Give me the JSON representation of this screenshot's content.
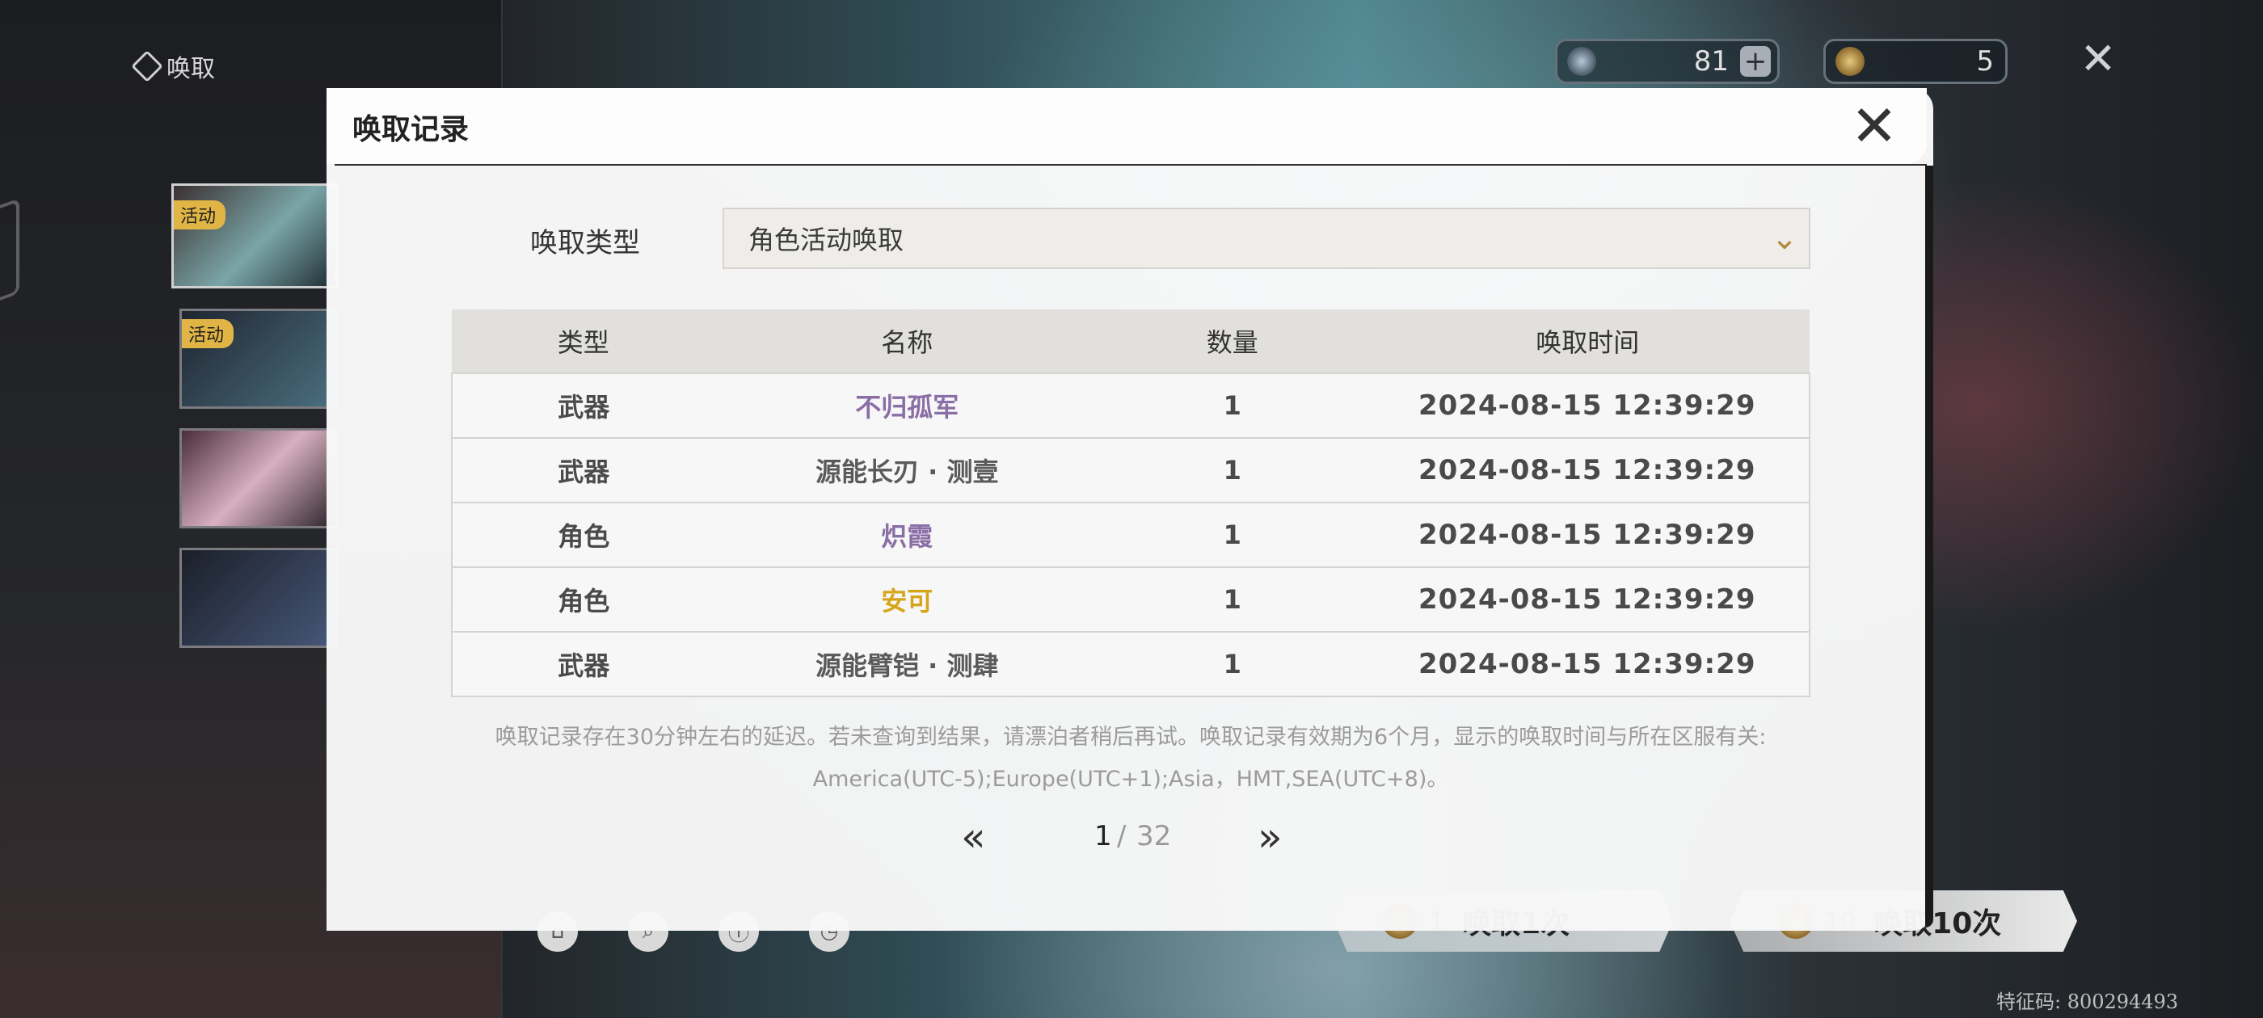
{
  "background": {
    "nav_title": "唤取",
    "side_tags": [
      "活动",
      "活动"
    ],
    "resources": {
      "star_count": "81",
      "coin_count": "5",
      "plus_label": "+"
    },
    "pull_buttons": {
      "single_label": "唤取1次",
      "single_cost": "1",
      "ten_label": "唤取10次",
      "ten_cost": "10"
    },
    "feature_code": "特征码: 800294493"
  },
  "modal": {
    "title": "唤取记录",
    "filter": {
      "label": "唤取类型",
      "selected": "角色活动唤取"
    },
    "table": {
      "headers": [
        "类型",
        "名称",
        "数量",
        "唤取时间"
      ],
      "rows": [
        {
          "type": "武器",
          "name": "不归孤军",
          "qty": "1",
          "time": "2024-08-15 12:39:29",
          "color": "#8a6ea6"
        },
        {
          "type": "武器",
          "name": "源能长刃 · 测壹",
          "qty": "1",
          "time": "2024-08-15 12:39:29",
          "color": "#5a5a5a"
        },
        {
          "type": "角色",
          "name": "炽霞",
          "qty": "1",
          "time": "2024-08-15 12:39:29",
          "color": "#8a6ea6"
        },
        {
          "type": "角色",
          "name": "安可",
          "qty": "1",
          "time": "2024-08-15 12:39:29",
          "color": "#d6a51a"
        },
        {
          "type": "武器",
          "name": "源能臂铠 · 测肆",
          "qty": "1",
          "time": "2024-08-15 12:39:29",
          "color": "#5a5a5a"
        }
      ]
    },
    "note_line1": "唤取记录存在30分钟左右的延迟。若未查询到结果，请漂泊者稍后再试。唤取记录有效期为6个月，显示的唤取时间与所在区服有关:",
    "note_line2": "America(UTC-5);Europe(UTC+1);Asia，HMT,SEA(UTC+8)。",
    "pager": {
      "current": "1",
      "separator": "/",
      "total": "32"
    }
  }
}
